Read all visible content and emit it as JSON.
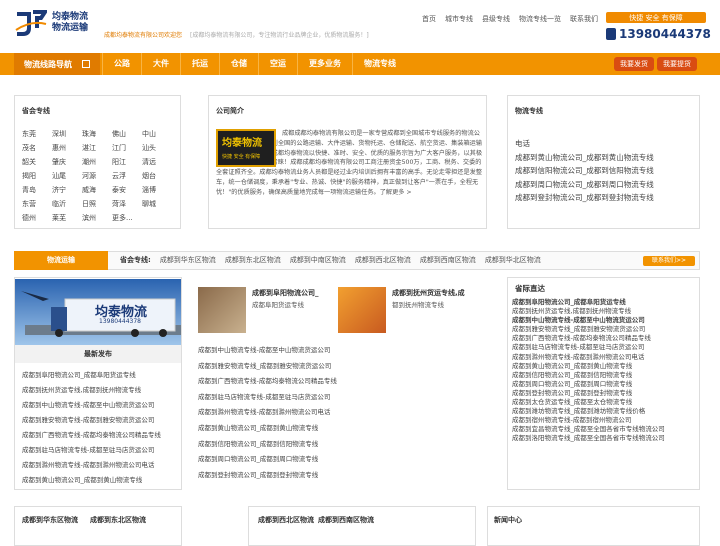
{
  "header": {
    "logo_line1": "均泰物流",
    "logo_line2": "物流运输",
    "slogan": "成都均泰物流有限公司欢迎您",
    "sub_slogan": "[成都均泰物流有限公司，专注物流行业品牌企业，优质物流服务！]",
    "topnav": [
      "首页",
      "城市专线",
      "县级专线",
      "物流专线一览",
      "联系我们"
    ],
    "badge": "快捷  安全  有保障",
    "phone": "13980444378"
  },
  "nav": {
    "guide": "物流线路导航",
    "items": [
      "公路",
      "大件",
      "托运",
      "仓储",
      "空运",
      "更多业务",
      "物流专线"
    ],
    "btn_ship": "我要发货",
    "btn_truck": "我要提货"
  },
  "cities_panel": {
    "title": "省会专线",
    "cities": [
      "东莞",
      "深圳",
      "珠海",
      "佛山",
      "中山",
      "茂名",
      "惠州",
      "湛江",
      "江门",
      "汕头",
      "韶关",
      "肇庆",
      "潮州",
      "阳江",
      "清远",
      "揭阳",
      "汕尾",
      "河源",
      "云浮",
      "烟台",
      "青岛",
      "济宁",
      "威海",
      "泰安",
      "淄博",
      "东营",
      "临沂",
      "日照",
      "菏泽",
      "聊城",
      "德州",
      "莱芜",
      "滨州",
      "更多..."
    ]
  },
  "intro": {
    "title": "公司简介",
    "img_title": "均泰物流",
    "img_sub": "快捷 安全 有保障",
    "text": "成都成都均泰物流有限公司是一家专营成都到全国城市专线服务的物流公司。主营业务：成都到全国的公路运输、大件运输、货物托运、仓储配送、航空货运、集装箱运输以及货物包装运输。成都均泰物流以快捷、准时、安全、优质的服务宗旨为广大客户服务，以其极具的性价比深受客户青睐！成都成都均泰物流有限公司工商注册资金500万，工商、税务、交委的全套证照齐全。成都均泰物流业务人员都是经过业内培训后拥有丰富的高手。无论走零担还是发整车，统一仓储调度，秉承着\"专业、热诚、快捷\"的服务精神，真正做到让客户\"一票在手，全程无忧！\"的优质服务，确保高质量地完成每一项物流运输任务。了解更多 >"
  },
  "lines_panel": {
    "title": "物流专线",
    "items": [
      "电话",
      "成都到黄山物流公司_成都到黄山物流专线",
      "成都到信阳物流公司_成都到信阳物流专线",
      "成都到周口物流公司_成都到周口物流专线",
      "成都到登封物流公司_成都到登封物流专线"
    ]
  },
  "strip": {
    "title": "物流运输",
    "label": "省会专线:",
    "links": [
      "成都到华东区物流",
      "成都到东北区物流",
      "成都到中南区物流",
      "成都到西北区物流",
      "成都到西南区物流",
      "成都到华北区物流"
    ],
    "more": "联系我们>>"
  },
  "left_col": {
    "truck_text": "均泰物流",
    "truck_phone": "13980444378",
    "newpub_title": "最新发布",
    "items": [
      "成都到阜阳物流公司_成都阜阳货运专线",
      "成都到抚州货运专线,成都到抚州物流专线",
      "成都到中山物流专线-成都至中山物流货运公司",
      "成都到雅安物流专线-成都到雅安物流货运公司",
      "成都到广西物流专线-成都均泰物流公司精品专线",
      "成都到驻马店物流专线-成都至驻马店货运公司",
      "成都到滁州物流专线-成都到滁州物流公司电话",
      "成都到黄山物流公司_成都到黄山物流专线"
    ]
  },
  "mid_col": {
    "card1_title": "成都到阜阳物流公司_",
    "card1_desc": "成都阜阳货运专线",
    "card2_title": "成都到抚州货运专线,成",
    "card2_desc": "都到抚州物流专线",
    "items": [
      "成都到中山物流专线-成都至中山物流货运公司",
      "成都到雅安物流专线_成都到雅安物流货运公司",
      "成都到广西物流专线-成都均泰物流公司精品专线",
      "成都到驻马店物流专线-成都至驻马店货运公司",
      "成都到滁州物流专线-成都到滁州物流公司电话",
      "成都到黄山物流公司_成都到黄山物流专线",
      "成都到信阳物流公司_成都到信阳物流专线",
      "成都到周口物流公司_成都到周口物流专线",
      "成都到登封物流公司_成都到登封物流专线"
    ]
  },
  "rec": {
    "title": "省际直达",
    "items": [
      "成都到阜阳物流公司_成都阜阳货运专线",
      "成都到抚州货运专线,成都到抚州物流专线",
      "成都到中山物流专线-成都至中山物流货运公司",
      "成都到雅安物流专线_成都到雅安物流货运公司",
      "成都到广西物流专线-成都均泰物流公司精品专线",
      "成都到驻马店物流专线-成都至驻马店货运公司",
      "成都到滁州物流专线-成都到滁州物流公司电话",
      "成都到黄山物流公司_成都到黄山物流专线",
      "成都到信阳物流公司_成都到信阳物流专线",
      "成都到周口物流公司_成都到周口物流专线",
      "成都到登封物流公司_成都到登封物流专线",
      "成都到太仓货运专线_成都至太仓物流专线",
      "成都到潍坊物流专线_成都到潍坊物流专线价格",
      "成都到宿州物流专线-成都到宿州物流公司",
      "成都到宜昌物流专线_成都至全国各省市专线物流公司",
      "成都到洛阳物流专线_成都至全国各省市专线物流公司"
    ]
  },
  "footer": {
    "items": [
      "成都到华东区物流",
      "成都到东北区物流",
      "成都到西北区物流",
      "成都到西南区物流",
      "新闻中心"
    ]
  }
}
